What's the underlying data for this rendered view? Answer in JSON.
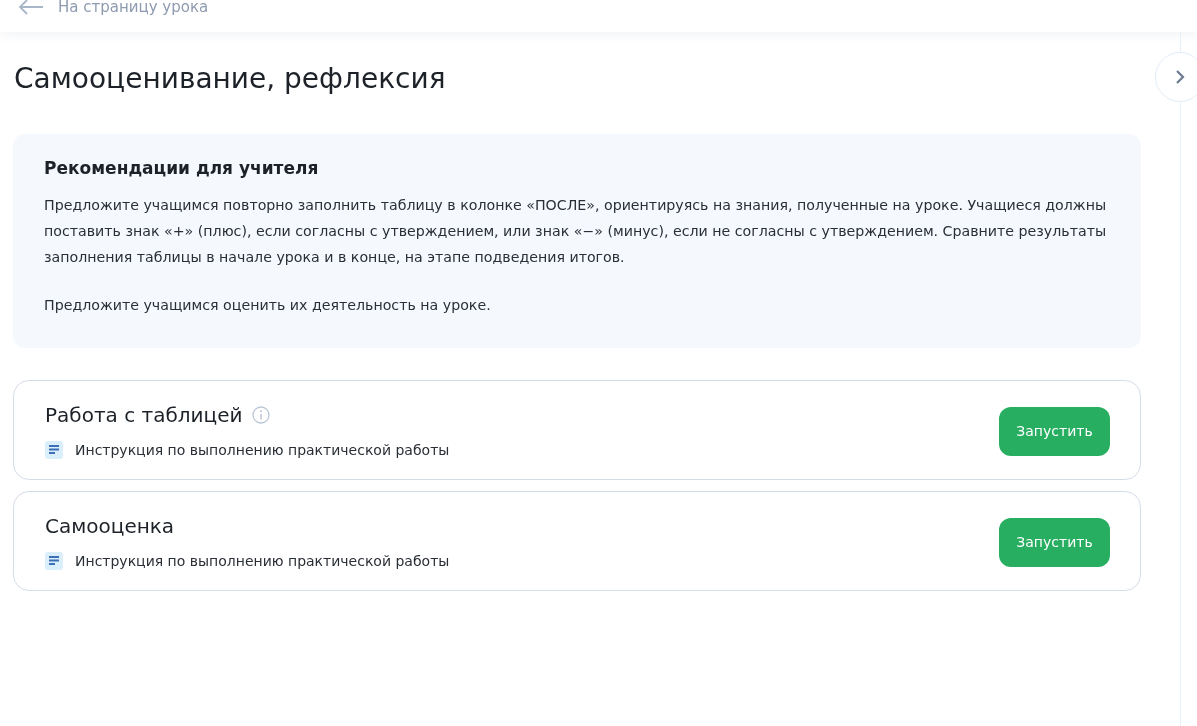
{
  "back_link": {
    "label": "На страницу урока"
  },
  "title": "Самооценивание, рефлексия",
  "recommendations": {
    "heading": "Рекомендации для учителя",
    "paragraphs": [
      "Предложите учащимся повторно заполнить таблицу в колонке «ПОСЛЕ», ориентируясь на знания, полученные на уроке. Учащиеся должны поставить знак «+» (плюс), если согласны с утверждением, или знак «−» (минус), если не согласны с утверждением. Сравните результаты заполнения таблицы в начале урока и в конце, на этапе подведения итогов.",
      "Предложите учащимся оценить их деятельность на уроке."
    ]
  },
  "activities": [
    {
      "title": "Работа с таблицей",
      "info": true,
      "instruction": "Инструкция по выполнению практической работы",
      "button": "Запустить"
    },
    {
      "title": "Самооценка",
      "info": false,
      "instruction": "Инструкция по выполнению практической работы",
      "button": "Запустить"
    }
  ]
}
